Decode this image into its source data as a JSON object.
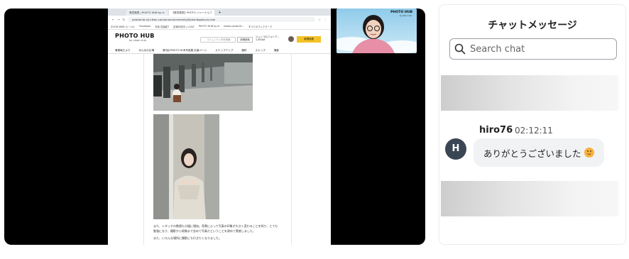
{
  "browser": {
    "tabs": [
      "受賞発表 | PHOTO HUB by ni",
      "【受賞発表】PHOTO ジャーナルフ"
    ],
    "new_tab": "+",
    "url": "photohub.nij.nikon.com/announcements/j5pdzmbgeeyca.com",
    "bookmarks": [
      "ZOOM WEB カーペル",
      "Facebook",
      "写真 右撮影T",
      "記事作成中 | LOGE",
      "PHOTO HUB by N",
      "studio.pardo.fb...",
      "すべてのブックマーク"
    ]
  },
  "site": {
    "logo": "PHOTO HUB",
    "logo_sub": "by nikon club",
    "search_placeholder": "コミュニティ内を検索",
    "advanced_search": "詳細検索",
    "community_line1": "ジュンコのフォトア...",
    "community_line2": "1,000pt",
    "post_button": "新規投稿",
    "nav": [
      "事務局だより",
      "みんなの広場",
      "第3回 PHOTO HUB写真展 応募ページ",
      "ステップアップ",
      "機材",
      "スナップ",
      "撮影"
    ],
    "caption_lines": [
      "また、レタッチの数値も大幅に増加。背景によって写真の印象が大きく変わることを知り、とても",
      "勉強になり、撮影から現像まで含めて写真だということを改めて実感しました。",
      "また、いろんな場所に撮影にも行きたくなりました。"
    ]
  },
  "camera_tile": {
    "logo": "PHOTO HUB",
    "logo_sub": "by nikon club"
  },
  "chat": {
    "title": "チャットメッセージ",
    "search_placeholder": "Search chat",
    "messages": [
      {
        "author": "hiro76",
        "time": "02:12:11",
        "avatar_initial": "H",
        "text": "ありがとうございました",
        "emoji": "smiling-face-emoji"
      }
    ]
  },
  "colors": {
    "stage_bg": "#000000",
    "avatar_bg": "#3b4654",
    "bubble_bg": "#f1f2f4",
    "post_button": "#f4c226",
    "camera_sky": "#8fcbea"
  }
}
